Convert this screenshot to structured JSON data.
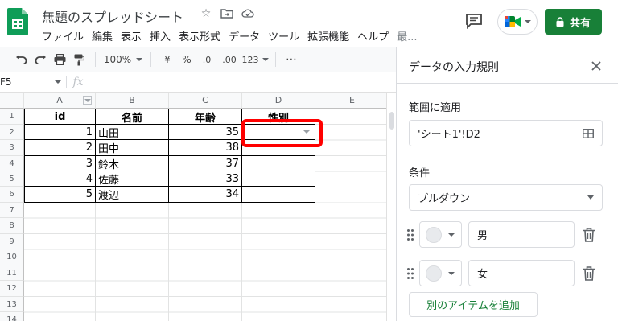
{
  "header": {
    "doc_title": "無題のスプレッドシート",
    "menu": [
      "ファイル",
      "編集",
      "表示",
      "挿入",
      "表示形式",
      "データ",
      "ツール",
      "拡張機能",
      "ヘルプ"
    ],
    "menu_more": "最...",
    "share_label": "共有",
    "accent_color": "#188038"
  },
  "toolbar": {
    "zoom": "100%",
    "currency": "¥",
    "percent": "%",
    "decimal_decrease": ".0",
    "decimal_increase": ".00",
    "format_more": "123",
    "more": "⋯"
  },
  "formula_bar": {
    "name_box": "F5",
    "fx": "fx",
    "value": ""
  },
  "sheet": {
    "columns": [
      "A",
      "B",
      "C",
      "D",
      "E"
    ],
    "rows": [
      "1",
      "2",
      "3",
      "4",
      "5",
      "6",
      "7",
      "8",
      "9",
      "10",
      "11",
      "12",
      "13",
      "14"
    ],
    "header_row": [
      "id",
      "名前",
      "年齢",
      "性別"
    ],
    "data_rows": [
      {
        "id": "1",
        "name": "山田",
        "age": "35",
        "gender": ""
      },
      {
        "id": "2",
        "name": "田中",
        "age": "38",
        "gender": ""
      },
      {
        "id": "3",
        "name": "鈴木",
        "age": "37",
        "gender": ""
      },
      {
        "id": "4",
        "name": "佐藤",
        "age": "33",
        "gender": ""
      },
      {
        "id": "5",
        "name": "渡辺",
        "age": "34",
        "gender": ""
      }
    ],
    "highlight_color": "#ff0000"
  },
  "panel": {
    "title": "データの入力規則",
    "range_label": "範囲に適用",
    "range_value": "'シート1'!D2",
    "criteria_label": "条件",
    "criteria_value": "プルダウン",
    "items": [
      "男",
      "女"
    ],
    "add_item_label": "別のアイテムを追加"
  }
}
